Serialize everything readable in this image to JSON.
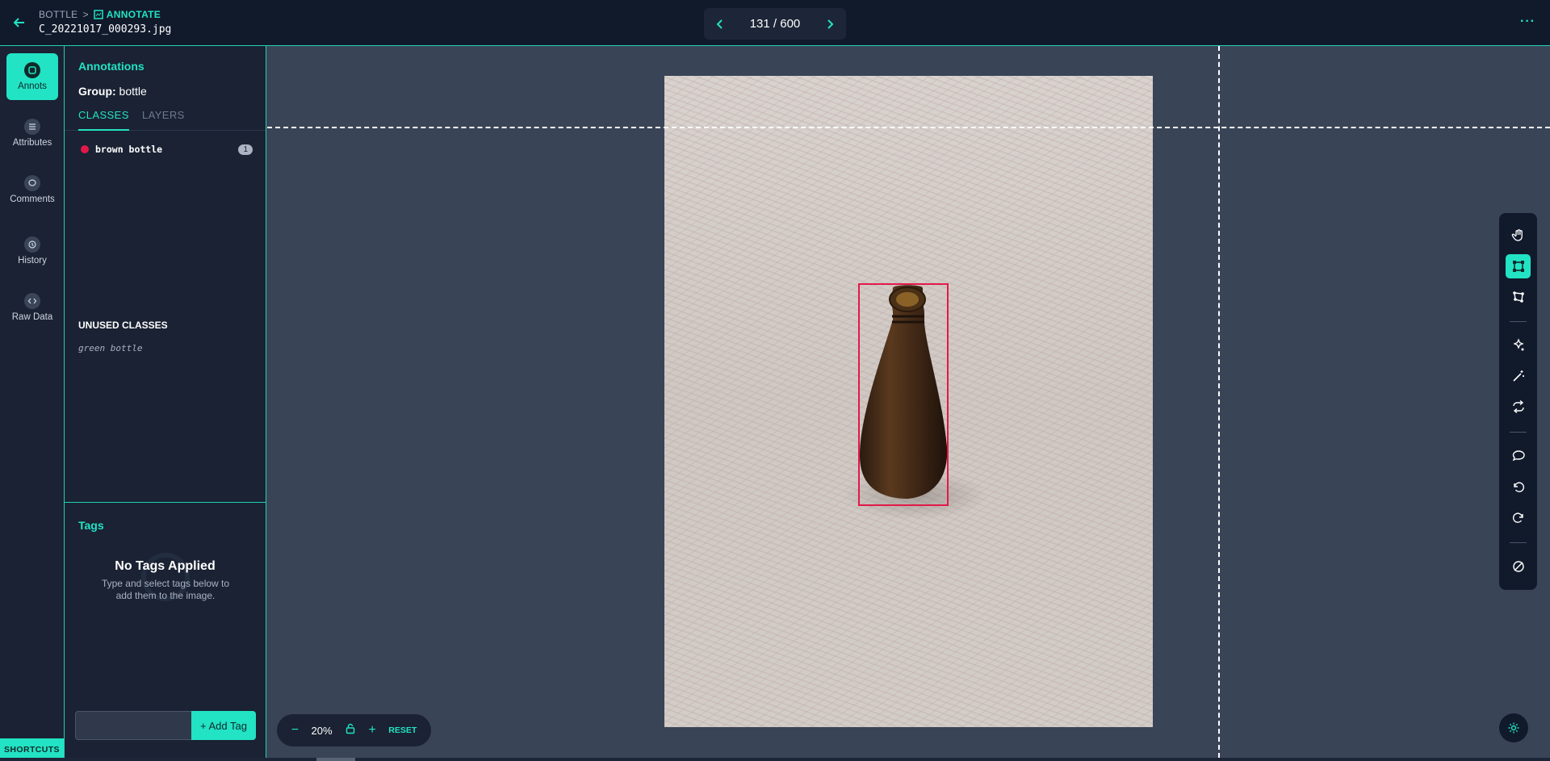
{
  "header": {
    "breadcrumb_project": "BOTTLE",
    "breadcrumb_separator": ">",
    "breadcrumb_current": "ANNOTATE",
    "filename": "C_20221017_000293.jpg",
    "pager_text": "131 / 600"
  },
  "rail": {
    "items": [
      {
        "label": "Annots",
        "icon": "annotations-icon"
      },
      {
        "label": "Attributes",
        "icon": "list-icon"
      },
      {
        "label": "Comments",
        "icon": "comment-icon"
      },
      {
        "label": "History",
        "icon": "history-icon"
      },
      {
        "label": "Raw Data",
        "icon": "code-icon"
      }
    ],
    "shortcuts_label": "SHORTCUTS"
  },
  "panel": {
    "title": "Annotations",
    "group_label": "Group:",
    "group_value": "bottle",
    "tabs": [
      "CLASSES",
      "LAYERS"
    ],
    "classes": [
      {
        "name": "brown bottle",
        "count": "1",
        "color": "#e3184a"
      }
    ],
    "unused_title": "UNUSED CLASSES",
    "unused_classes": [
      "green bottle"
    ],
    "tags_title": "Tags",
    "no_tags_title": "No Tags Applied",
    "no_tags_desc": "Type and select tags below to add them to the image.",
    "tag_input_placeholder": "",
    "add_tag_label": "+ Add Tag"
  },
  "canvas": {
    "zoom": "20%",
    "reset_label": "RESET",
    "annotation_color": "#e3184a"
  },
  "toolbar": {
    "tools": [
      "hand-tool-icon",
      "bounding-box-icon",
      "polygon-icon",
      "auto-detect-icon",
      "magic-wand-icon",
      "loop-icon",
      "comment-icon",
      "undo-icon",
      "redo-icon",
      "disable-icon"
    ],
    "active_tool": "bounding-box-icon"
  },
  "colors": {
    "accent": "#22e3c4",
    "topbar": "#111a2b",
    "panel": "#1a2233",
    "canvas": "#3a4457"
  }
}
